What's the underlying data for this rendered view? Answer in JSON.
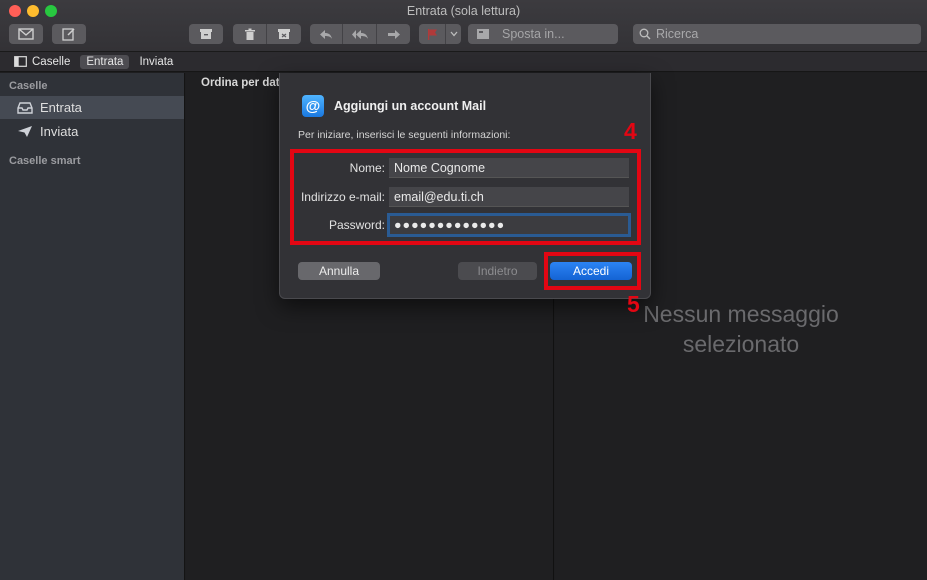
{
  "window": {
    "title": "Entrata (sola lettura)"
  },
  "toolbar": {
    "icons": [
      "envelope-icon",
      "compose-icon",
      "archive-icon",
      "trash-icon",
      "junk-icon",
      "reply-icon",
      "reply-all-icon",
      "forward-icon",
      "flag-icon",
      "chevron-down-icon",
      "move-icon",
      "search-icon"
    ],
    "move_label": "Sposta in...",
    "search_placeholder": "Ricerca"
  },
  "favorites": {
    "mailboxes_label": "Caselle",
    "inbox_label": "Entrata",
    "sent_label": "Inviata"
  },
  "sidebar": {
    "section_mailboxes": "Caselle",
    "items": [
      {
        "label": "Entrata",
        "icon": "inbox-icon",
        "selected": true
      },
      {
        "label": "Inviata",
        "icon": "sent-icon",
        "selected": false
      }
    ],
    "section_smart": "Caselle smart"
  },
  "message_list": {
    "sort_label": "Ordina per data"
  },
  "preview": {
    "empty_line1": "Nessun messaggio",
    "empty_line2": "selezionato"
  },
  "dialog": {
    "icon": "at-sign-icon",
    "title": "Aggiungi un account Mail",
    "subtitle": "Per iniziare, inserisci le seguenti informazioni:",
    "fields": {
      "name_label": "Nome:",
      "name_value": "Nome Cognome",
      "email_label": "Indirizzo e-mail:",
      "email_value": "email@edu.ti.ch",
      "password_label": "Password:",
      "password_value": "●●●●●●●●●●●●●"
    },
    "buttons": {
      "cancel": "Annulla",
      "back": "Indietro",
      "login": "Accedi"
    }
  },
  "annotations": {
    "step_fields": "4",
    "step_login": "5"
  },
  "colors": {
    "annotation_red": "#e30613",
    "accent_blue": "#1a6fe6"
  }
}
